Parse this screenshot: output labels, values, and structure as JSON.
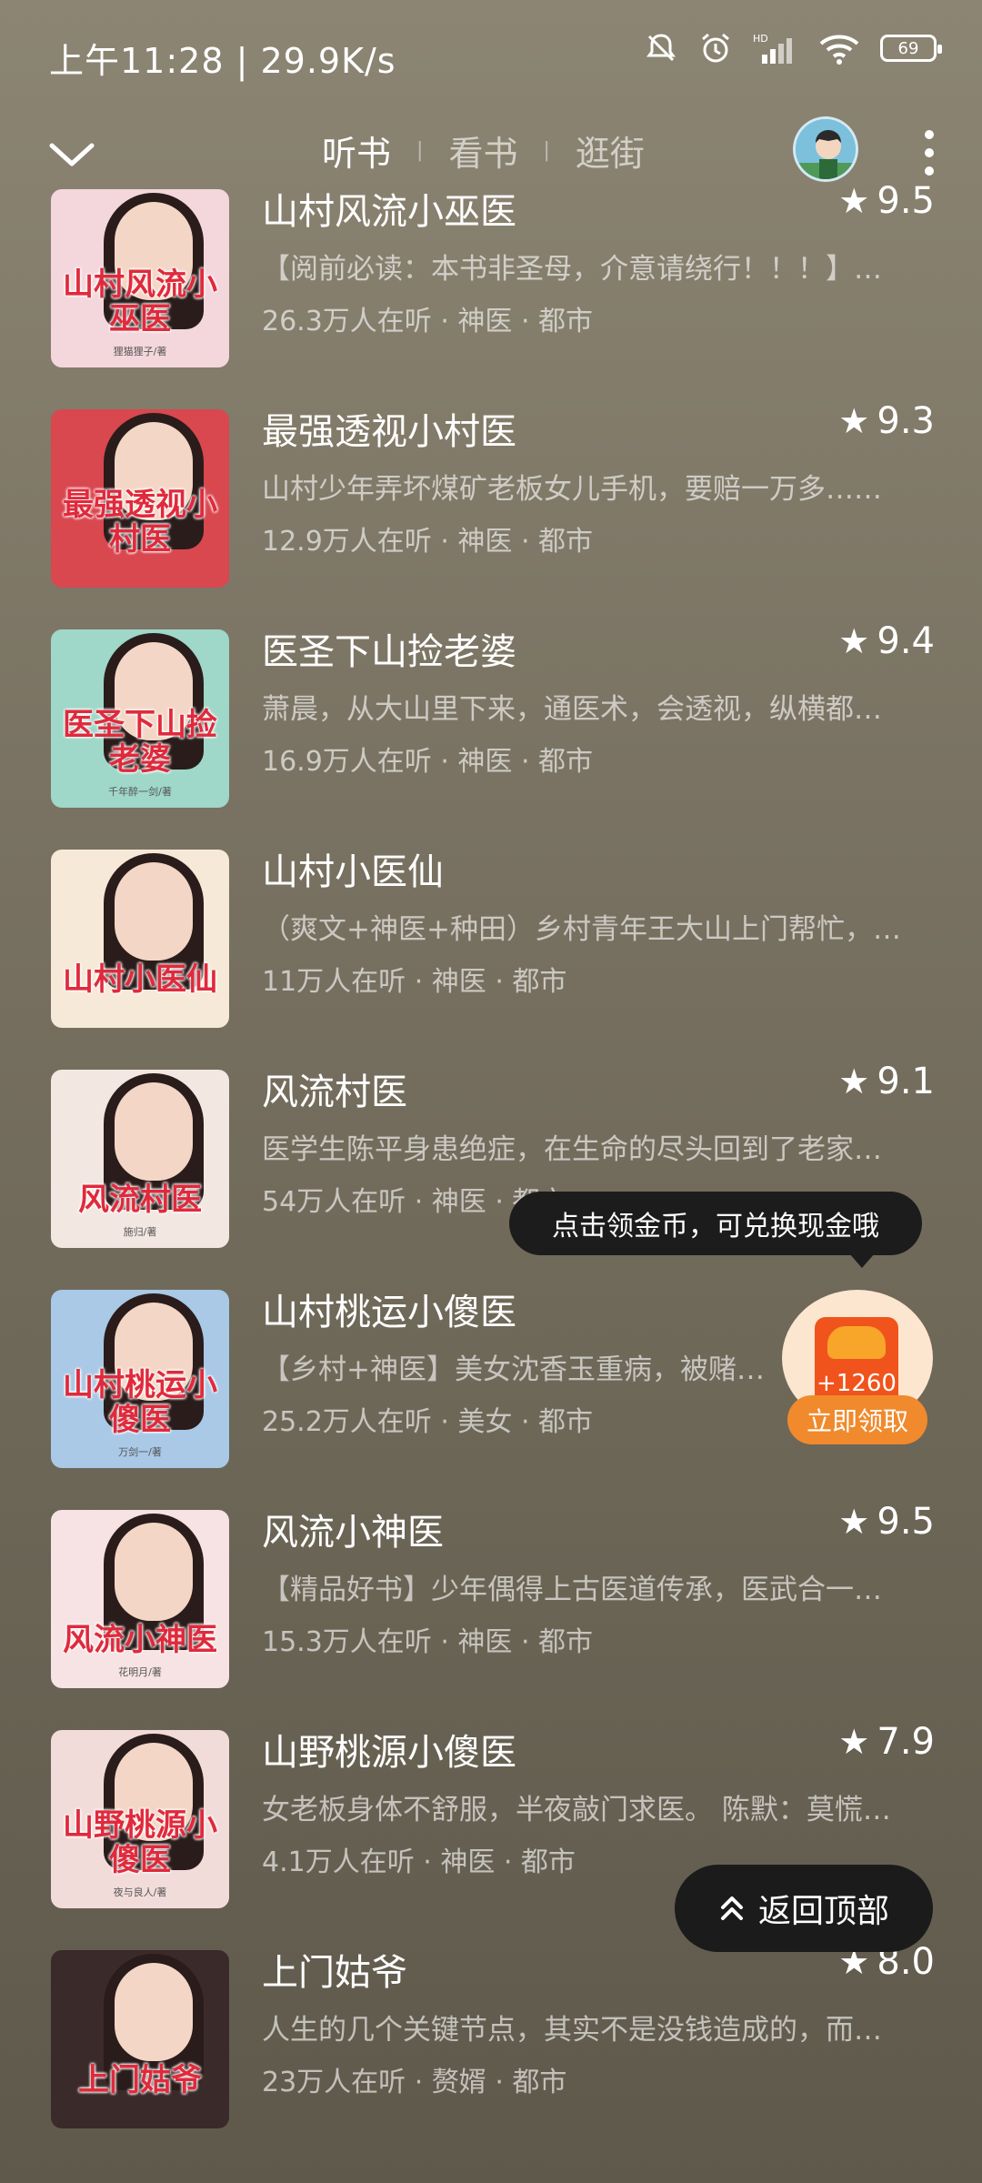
{
  "status_bar": {
    "time": "上午11:28 | 29.9K/s",
    "battery": "69"
  },
  "header": {
    "tabs": [
      {
        "label": "听书",
        "active": true
      },
      {
        "label": "看书",
        "active": false
      },
      {
        "label": "逛街",
        "active": false
      }
    ]
  },
  "books": [
    {
      "title": "山村风流小巫医",
      "rating": "9.5",
      "desc": "【阅前必读：本书非圣母，介意请绕行！！！】…",
      "meta": "26.3万人在听 · 神医 · 都市",
      "cover_text": "山村风流小巫医",
      "cover_author": "狸猫狸子/著",
      "cover_color": "#f4d7dc"
    },
    {
      "title": "最强透视小村医",
      "rating": "9.3",
      "desc": "山村少年弄坏煤矿老板女儿手机，要赔一万多……",
      "meta": "12.9万人在听 · 神医 · 都市",
      "cover_text": "最强透视小村医",
      "cover_author": "",
      "cover_color": "#d9474f"
    },
    {
      "title": "医圣下山捡老婆",
      "rating": "9.4",
      "desc": "萧晨，从大山里下来，通医术，会透视，纵横都…",
      "meta": "16.9万人在听 · 神医 · 都市",
      "cover_text": "医圣下山捡老婆",
      "cover_author": "千年醉一剑/著",
      "cover_color": "#9fd7c8"
    },
    {
      "title": "山村小医仙",
      "rating": "",
      "desc": "（爽文+神医+种田）乡村青年王大山上门帮忙，…",
      "meta": "11万人在听 · 神医 · 都市",
      "cover_text": "山村小医仙",
      "cover_author": "",
      "cover_color": "#f6e9d8"
    },
    {
      "title": "风流村医",
      "rating": "9.1",
      "desc": "医学生陈平身患绝症，在生命的尽头回到了老家…",
      "meta": "54万人在听 · 神医 · 都市",
      "cover_text": "风流村医",
      "cover_author": "施归/著",
      "cover_color": "#f3e7e2"
    },
    {
      "title": "山村桃运小傻医",
      "rating": "",
      "desc": "【乡村+神医】美女沈香玉重病，被赌狗…",
      "meta": "25.2万人在听 · 美女 · 都市",
      "cover_text": "山村桃运小傻医",
      "cover_author": "万剑一/著",
      "cover_color": "#a9c9e6"
    },
    {
      "title": "风流小神医",
      "rating": "9.5",
      "desc": "【精品好书】少年偶得上古医道传承，医武合一…",
      "meta": "15.3万人在听 · 神医 · 都市",
      "cover_text": "风流小神医",
      "cover_author": "花明月/著",
      "cover_color": "#f7e2e4"
    },
    {
      "title": "山野桃源小傻医",
      "rating": "7.9",
      "desc": "女老板身体不舒服，半夜敲门求医。 陈默：莫慌…",
      "meta": "4.1万人在听 · 神医 · 都市",
      "cover_text": "山野桃源小傻医",
      "cover_author": "夜与良人/著",
      "cover_color": "#f2dcd9"
    },
    {
      "title": "上门姑爷",
      "rating": "8.0",
      "desc": "人生的几个关键节点，其实不是没钱造成的，而…",
      "meta": "23万人在听 · 赘婿 · 都市",
      "cover_text": "上门姑爷",
      "cover_author": "",
      "cover_color": "#3a2a2a"
    }
  ],
  "tooltip": "点击领金币，可兑换现金哦",
  "coin_widget": {
    "amount": "+1260",
    "button": "立即领取"
  },
  "back_to_top": "返回顶部"
}
